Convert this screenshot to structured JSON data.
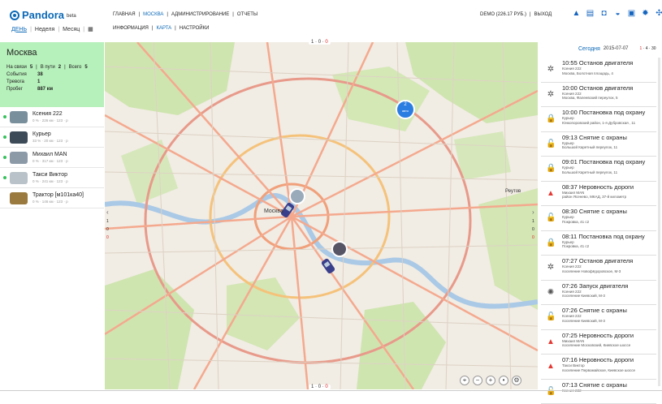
{
  "app": {
    "logo": "Pandora",
    "beta": "beta"
  },
  "period": {
    "day": "ДЕНЬ",
    "week": "Неделя",
    "month": "Месяц",
    "sep": "|"
  },
  "nav": {
    "main": [
      "ГЛАВНАЯ",
      "МОСКВА",
      "АДМИНИСТРИРОВАНИЕ",
      "ОТЧЕТЫ"
    ],
    "sub": [
      "ИНФОРМАЦИЯ",
      "КАРТА",
      "НАСТРОЙКИ"
    ],
    "sep": "|"
  },
  "account": {
    "balance": "DEMO (226.17 РУБ.)",
    "logout": "ВЫХОД",
    "sep": "|"
  },
  "summary": {
    "city": "Москва",
    "on_link_label": "На связи",
    "on_link": "5",
    "on_way_label": "В пути",
    "on_way": "2",
    "total_label": "Всего",
    "total": "5",
    "events_label": "События",
    "events": "38",
    "alarm_label": "Тревога",
    "alarm": "1",
    "mileage_label": "Пробег",
    "mileage": "887 км"
  },
  "vehicles": [
    {
      "name": "Ксения 222",
      "status": "0 % · 226 км · 123 · р",
      "online": true,
      "color": "#7a8f9c"
    },
    {
      "name": "Курьер",
      "status": "33 % · 20 км · 123 · р",
      "online": true,
      "color": "#3d4a57"
    },
    {
      "name": "Михаил MAN",
      "status": "0 % · 317 км · 123 · р",
      "online": true,
      "color": "#8c9aa8"
    },
    {
      "name": "Такси Виктор",
      "status": "0 % · 241 км · 123 · р",
      "online": true,
      "color": "#b9c2c8"
    },
    {
      "name": "Трактор [м101ка40]",
      "status": "0 % · 146 км · 123 · р",
      "online": false,
      "color": "#9a7a3e"
    }
  ],
  "map": {
    "cluster_count": "2",
    "cluster_label": "авто",
    "center_label": "Москва",
    "reutov_label": "Реутов",
    "pager": {
      "left": "1",
      "mid": "0",
      "right": "0"
    },
    "pager_bottom": {
      "left": "1",
      "mid": "0",
      "right": "0"
    },
    "controls": [
      "⌖",
      "−",
      "+",
      "•",
      "⚙"
    ],
    "side_left": [
      "‹",
      "1",
      "0",
      "0"
    ],
    "side_right": [
      "›",
      "1",
      "0",
      "0"
    ]
  },
  "journal": {
    "today": "Сегодня",
    "date": "2015-07-07",
    "pages": [
      "1",
      "4",
      "30"
    ],
    "events": [
      {
        "time": "10:55",
        "title": "Останов двигателя",
        "icon": "gear",
        "lines": [
          "Ксения 222",
          "Москва, Болотная площадь, 4"
        ]
      },
      {
        "time": "10:00",
        "title": "Останов двигателя",
        "icon": "gear",
        "lines": [
          "Ксения 222",
          "Москва, Фалеевский переулок, 5"
        ]
      },
      {
        "time": "10:00",
        "title": "Постановка под охрану",
        "icon": "lock",
        "lines": [
          "Курьер",
          "Юнкопоровский район, 1-я Дубровская , 11"
        ]
      },
      {
        "time": "09:13",
        "title": "Снятие с охраны",
        "icon": "unlock",
        "lines": [
          "Курьер",
          "Большой Каретный переулок, 11"
        ]
      },
      {
        "time": "09:01",
        "title": "Постановка под охрану",
        "icon": "lock",
        "lines": [
          "Курьер",
          "Большой Каретный переулок, 11"
        ]
      },
      {
        "time": "08:37",
        "title": "Неровность дороги",
        "icon": "warn",
        "lines": [
          "Михаил MAN",
          "район Ясенево, МКАД, 37-й километр"
        ]
      },
      {
        "time": "08:30",
        "title": "Снятие с охраны",
        "icon": "unlock",
        "lines": [
          "Курьер",
          "Покровка, 41 с2"
        ]
      },
      {
        "time": "08:11",
        "title": "Постановка под охрану",
        "icon": "lock",
        "lines": [
          "Курьер",
          "Покровка, 41 с2"
        ]
      },
      {
        "time": "07:27",
        "title": "Останов двигателя",
        "icon": "gear",
        "lines": [
          "Ксения 222",
          "поселение Новофёдоровское, М-3"
        ]
      },
      {
        "time": "07:26",
        "title": "Запуск двигателя",
        "icon": "gear2",
        "lines": [
          "Ксения 222",
          "поселение Киевский, М-3"
        ]
      },
      {
        "time": "07:26",
        "title": "Снятие с охраны",
        "icon": "unlock",
        "lines": [
          "Ксения 222",
          "поселение Киевский, М-3"
        ]
      },
      {
        "time": "07:25",
        "title": "Неровность дороги",
        "icon": "warn",
        "lines": [
          "Михаил MAN",
          "поселение Московский, Киевское шоссе"
        ]
      },
      {
        "time": "07:16",
        "title": "Неровность дороги",
        "icon": "warn",
        "lines": [
          "Такси Виктор",
          "поселение Первомайское, Киевское шоссе"
        ]
      },
      {
        "time": "07:13",
        "title": "Снятие с охраны",
        "icon": "unlock",
        "lines": [
          "Ксения 222",
          ""
        ]
      }
    ]
  },
  "colors": {
    "accent": "#0c69b7",
    "summary_bg": "#b6f0ba",
    "online": "#36c25b",
    "alert": "#e53935"
  }
}
